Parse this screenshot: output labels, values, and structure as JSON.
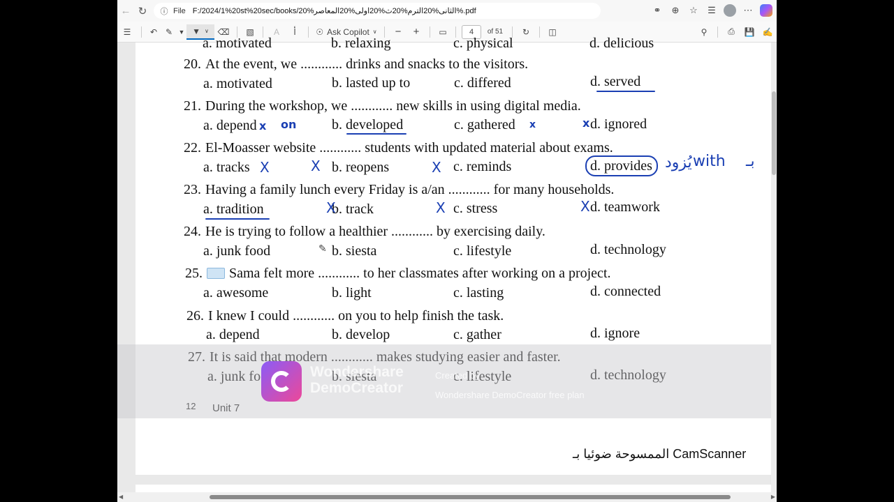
{
  "address_bar": {
    "file_label": "File",
    "url": "F:/2024/1%20st%20sec/books/20%الثانى%20الترم%20ث%20اولى%20المعاصر%.pdf"
  },
  "toolbar": {
    "ask_copilot": "Ask Copilot",
    "page_number": "4",
    "page_total": "of 51",
    "zoom_out": "−",
    "zoom_in": "+"
  },
  "questions": [
    {
      "num": "",
      "text": "",
      "options": [
        "a. motivated",
        "b. relaxing",
        "c. physical",
        "d. delicious"
      ]
    },
    {
      "num": "20.",
      "text": "At the event, we ............ drinks and snacks to the visitors.",
      "options": [
        "a. motivated",
        "b. lasted up to",
        "c. differed",
        "d. served"
      ]
    },
    {
      "num": "21.",
      "text": "During the workshop, we ............ new skills in using digital media.",
      "options": [
        "a. depend",
        "b. developed",
        "c. gathered",
        "d. ignored"
      ]
    },
    {
      "num": "22.",
      "text": "El-Moasser website ............ students with updated material about exams.",
      "options": [
        "a. tracks",
        "b. reopens",
        "c. reminds",
        "d. provides"
      ]
    },
    {
      "num": "23.",
      "text": "Having a family lunch every Friday is a/an ............ for many households.",
      "options": [
        "a. tradition",
        "b. track",
        "c. stress",
        "d. teamwork"
      ]
    },
    {
      "num": "24.",
      "text": "He is trying to follow a healthier ............ by exercising daily.",
      "options": [
        "a. junk food",
        "b. siesta",
        "c. lifestyle",
        "d. technology"
      ]
    },
    {
      "num": "25.",
      "text": "Sama felt more ............ to her classmates after working on a project.",
      "options": [
        "a. awesome",
        "b. light",
        "c. lasting",
        "d. connected"
      ]
    },
    {
      "num": "26.",
      "text": "I knew I could ............ on you to help finish the task.",
      "options": [
        "a. depend",
        "b. develop",
        "c. gather",
        "d. ignore"
      ]
    },
    {
      "num": "27.",
      "text": "It is said that modern ............ makes studying easier and faster.",
      "options": [
        "a. junk food",
        "b. siesta",
        "c. lifestyle",
        "d. technology"
      ]
    }
  ],
  "handwriting": {
    "on": "on",
    "with": "with",
    "arabic_note": "يُزود",
    "arabic_note2": "بـ"
  },
  "footer": {
    "page_no": "12",
    "unit": "Unit 7",
    "camscanner": "الممسوحة ضوئيا بـ CamScanner"
  },
  "watermark": {
    "brand_line1": "Wondershare",
    "brand_line2": "DemoCreator",
    "plan_line1": "Created by",
    "plan_line2": "Wondershare DemoCreator free plan"
  },
  "colors": {
    "ink": "#1a3fb3",
    "accent": "#0067c0"
  }
}
